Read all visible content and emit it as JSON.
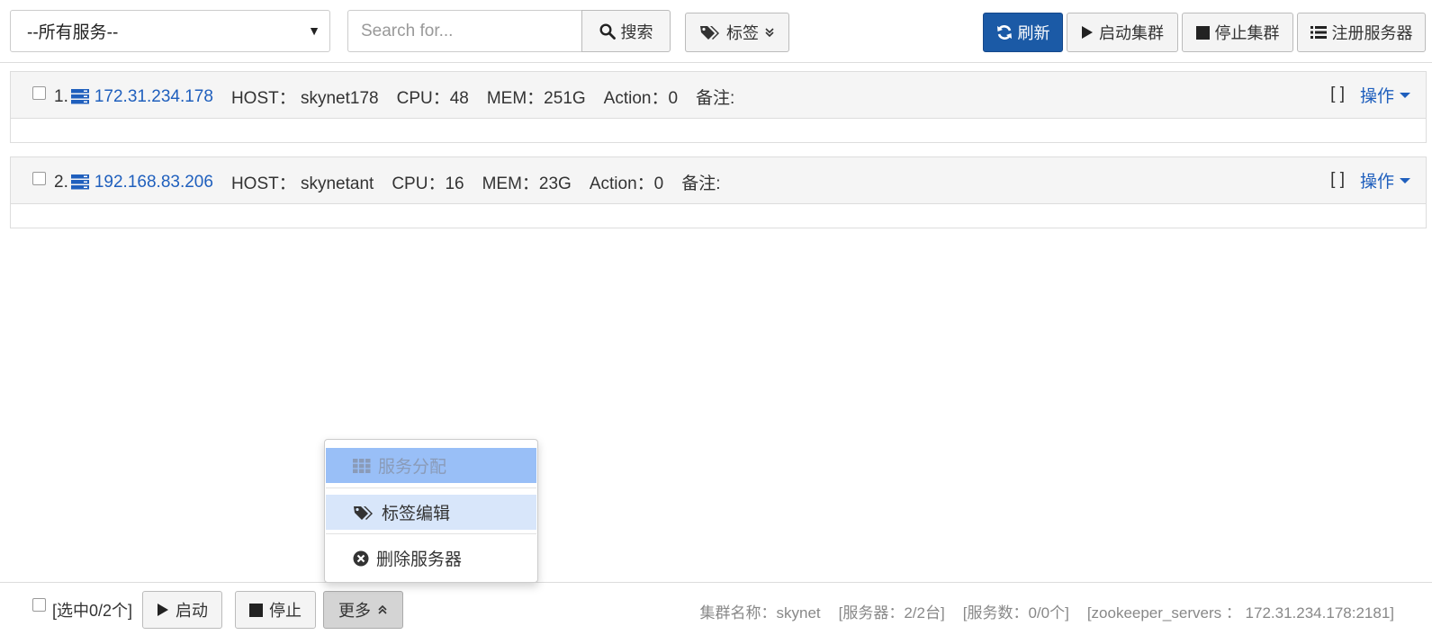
{
  "toolbar": {
    "service_select": "--所有服务--",
    "search_placeholder": "Search for...",
    "search_button": "搜索",
    "tags_button": "标签",
    "refresh_button": "刷新",
    "start_cluster_button": "启动集群",
    "stop_cluster_button": "停止集群",
    "register_server_button": "注册服务器"
  },
  "servers": [
    {
      "index": "1.",
      "ip": "172.31.234.178",
      "host": "HOST：  skynet178",
      "cpu": "CPU：48",
      "mem": "MEM：251G",
      "action": "Action：0",
      "note": "备注:",
      "brackets": "[ ]",
      "ops": "操作"
    },
    {
      "index": "2.",
      "ip": "192.168.83.206",
      "host": "HOST：  skynetant",
      "cpu": "CPU：16",
      "mem": "MEM：23G",
      "action": "Action：0",
      "note": "备注:",
      "brackets": "[ ]",
      "ops": "操作"
    }
  ],
  "more_menu": {
    "items": [
      {
        "label": "服务分配",
        "icon": "grid-icon"
      },
      {
        "label": "标签编辑",
        "icon": "tags-icon"
      },
      {
        "label": "删除服务器",
        "icon": "times-circle-icon"
      }
    ]
  },
  "footer": {
    "selected_label": "[选中0/2个]",
    "start_button": "启动",
    "stop_button": "停止",
    "more_button": "更多",
    "cluster_name": "集群名称：skynet",
    "server_count": "[服务器：2/2台]",
    "service_count": "[服务数：0/0个]",
    "zookeeper": "[zookeeper_servers ： 172.31.234.178:2181]"
  },
  "colors": {
    "primary": "#1b5aa6",
    "link": "#1f5fbd",
    "menu_active": "#99bff7",
    "menu_hover": "#d8e6fa"
  }
}
